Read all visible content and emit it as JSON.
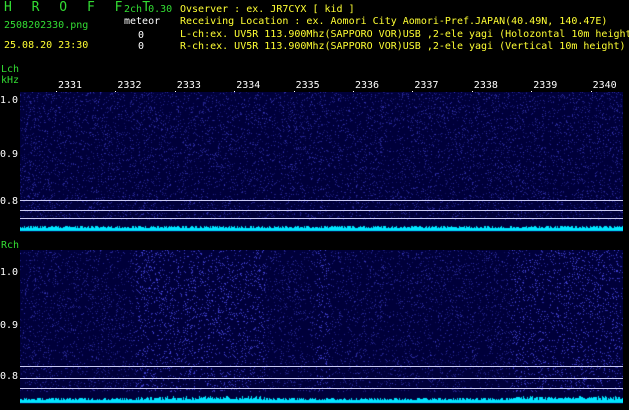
{
  "header": {
    "title": "H R O F F T",
    "mode": "2ch 0.30",
    "meteor_label": "meteor",
    "filename": "2508202330.png",
    "datetime": "25.08.20 23:30",
    "count_a": "0",
    "count_b": "0",
    "observer": "Ovserver              : ex. JR7CYX [ kid ]",
    "location": "Receiving Location : ex. Aomori City Aomori-Pref.JAPAN(40.49N, 140.47E)",
    "lch_info": "L-ch:ex. UV5R 113.900Mhz(SAPPORO VOR)USB ,2-ele yagi (Holozontal 10m height)",
    "rch_info": "R-ch:ex. UV5R 113.900Mhz(SAPPORO VOR)USB ,2-ele yagi (Vertical 10m height)"
  },
  "axes": {
    "lch_label": "Lch",
    "khz_label": "kHz",
    "rch_label": "Rch",
    "time_ticks": [
      "2331",
      "2332",
      "2333",
      "2334",
      "2335",
      "2336",
      "2337",
      "2338",
      "2339",
      "2340"
    ],
    "freq_ticks": [
      "1.0",
      "0.9",
      "0.8"
    ]
  },
  "colors": {
    "background": "#000000",
    "panel": "#00003a",
    "signal": "#00e5ff",
    "label_green": "#33dd33",
    "label_yellow": "#ffff33"
  }
}
